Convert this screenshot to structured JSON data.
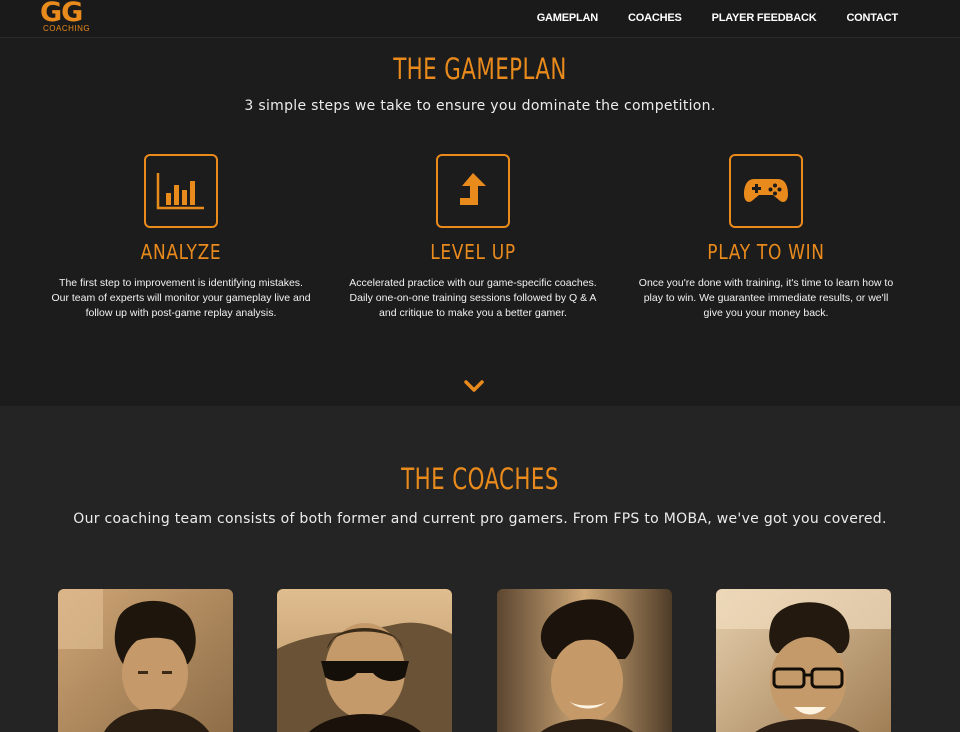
{
  "nav": {
    "logo": {
      "mark": "GG",
      "subtitle": "COACHING"
    },
    "links": [
      "GAMEPLAN",
      "COACHES",
      "PLAYER FEEDBACK",
      "CONTACT"
    ]
  },
  "gameplan": {
    "title": "THE GAMEPLAN",
    "subtitle": "3 simple steps we take to ensure you dominate the competition.",
    "steps": [
      {
        "icon": "bar-chart-icon",
        "title": "ANALYZE",
        "text": "The first step to improvement is identifying mistakes. Our team of experts will monitor your gameplay live and follow up with post-game replay analysis."
      },
      {
        "icon": "level-up-arrow-icon",
        "title": "LEVEL UP",
        "text": "Accelerated practice with our game-specific coaches. Daily one-on-one training sessions followed by Q & A and critique to make you a better gamer."
      },
      {
        "icon": "gamepad-icon",
        "title": "PLAY TO WIN",
        "text": "Once you're done with training, it's time to learn how to play to win. We guarantee immediate results, or we'll give you your money back."
      }
    ],
    "scroll_icon": "chevron-down-icon"
  },
  "coaches": {
    "title": "THE COACHES",
    "subtitle": "Our coaching team consists of both former and current pro gamers. From FPS to MOBA, we've got you covered.",
    "photos": [
      "coach-photo-1",
      "coach-photo-2",
      "coach-photo-3",
      "coach-photo-4"
    ]
  },
  "colors": {
    "accent": "#e98a1c",
    "background": "#1c1c1c",
    "background_alt": "#242424",
    "text": "#ffffff"
  }
}
